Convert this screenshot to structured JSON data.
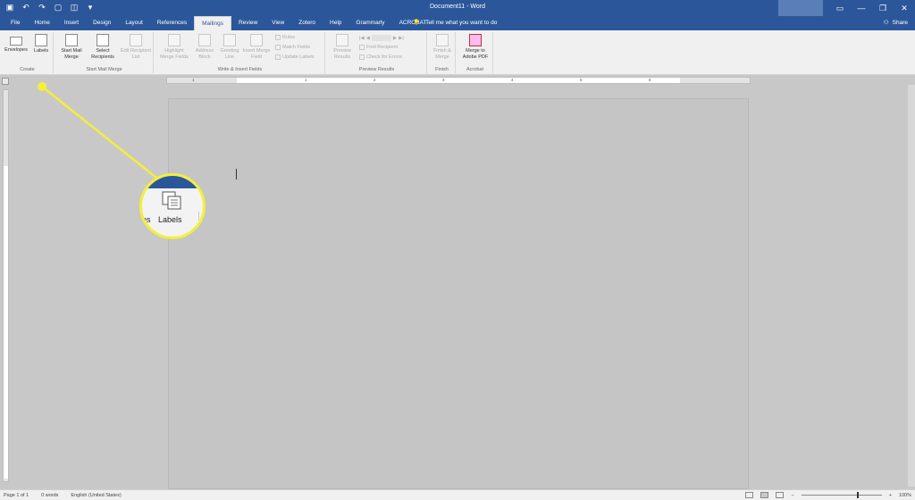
{
  "window": {
    "title": "Document11 - Word",
    "controls": [
      "minimize-icon",
      "restore-icon",
      "close-icon"
    ]
  },
  "quick_access": [
    "save-icon",
    "undo-icon",
    "redo-icon",
    "new-doc-icon",
    "open-icon",
    "customize-icon"
  ],
  "tabs": [
    {
      "label": "File"
    },
    {
      "label": "Home"
    },
    {
      "label": "Insert"
    },
    {
      "label": "Design"
    },
    {
      "label": "Layout"
    },
    {
      "label": "References"
    },
    {
      "label": "Mailings",
      "active": true
    },
    {
      "label": "Review"
    },
    {
      "label": "View"
    },
    {
      "label": "Zotero"
    },
    {
      "label": "Help"
    },
    {
      "label": "Grammarly"
    },
    {
      "label": "ACROBAT"
    }
  ],
  "tell_me": "Tell me what you want to do",
  "share": "Share",
  "ribbon": {
    "create": {
      "label": "Create",
      "envelopes": "Envelopes",
      "labels": "Labels"
    },
    "start_mail_merge": {
      "label": "Start Mail Merge",
      "start": "Start Mail Merge",
      "select": "Select Recipients",
      "edit": "Edit Recipient List"
    },
    "write_insert": {
      "label": "Write & Insert Fields",
      "highlight": "Highlight Merge Fields",
      "address": "Address Block",
      "greeting": "Greeting Line",
      "insert_merge": "Insert Merge Field",
      "rules": "Rules",
      "match": "Match Fields",
      "update": "Update Labels"
    },
    "preview": {
      "label": "Preview Results",
      "preview": "Preview Results",
      "find": "Find Recipient",
      "check": "Check for Errors"
    },
    "finish": {
      "label": "Finish",
      "finish": "Finish & Merge"
    },
    "acrobat": {
      "label": "Acrobat",
      "merge_pdf": "Merge to Adobe PDF"
    }
  },
  "ruler_numbers": [
    "1",
    "1",
    "2",
    "3",
    "4",
    "5",
    "6"
  ],
  "callout": {
    "label": "Labels",
    "left_fragment": "es"
  },
  "status": {
    "page": "Page 1 of 1",
    "words": "0 words",
    "language": "English (United States)",
    "zoom": "100%"
  },
  "accent_color": "#2b579a",
  "highlight_color": "#f4ef3a"
}
